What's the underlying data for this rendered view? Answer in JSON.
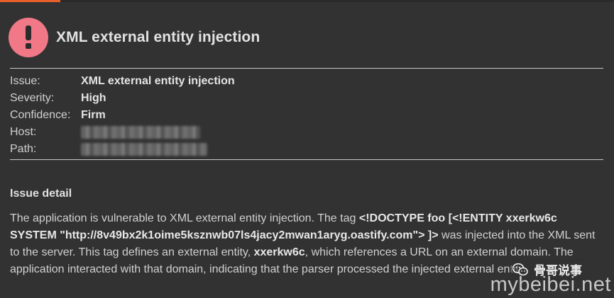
{
  "header": {
    "title": "XML external entity injection"
  },
  "colors": {
    "severity_high": "#f07887",
    "tab_accent": "#e8602c",
    "background": "#323232"
  },
  "details": {
    "issue_label": "Issue:",
    "issue_value": "XML external entity injection",
    "severity_label": "Severity:",
    "severity_value": "High",
    "confidence_label": "Confidence:",
    "confidence_value": "Firm",
    "host_label": "Host:",
    "path_label": "Path:"
  },
  "issue_detail": {
    "heading": "Issue detail",
    "t1": "The application is vulnerable to XML external entity injection. The tag ",
    "b1": "<!DOCTYPE foo [<!ENTITY xxerkw6c SYSTEM \"http://8v49bx2k1oime5ksznwb07ls4jacy2mwan1aryg.oastify.com\"> ]>",
    "t2": " was injected into the XML sent to the server. This tag defines an external entity, ",
    "b2": "xxerkw6c",
    "t3": ", which references a URL on an external domain. The application interacted with that domain, indicating that the parser processed the injected external entity."
  },
  "watermark": {
    "wechat_label": "骨哥说事",
    "site": "mybeibei.net"
  }
}
